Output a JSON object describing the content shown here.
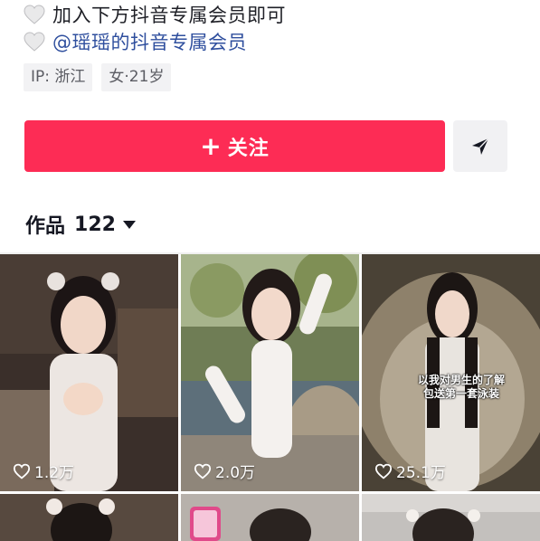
{
  "bio": {
    "line1": "加入下方抖音专属会员即可",
    "line2": "@瑶瑶的抖音专属会员"
  },
  "tags": [
    {
      "label": "IP: 浙江"
    },
    {
      "label": "女·21岁"
    }
  ],
  "actions": {
    "follow_label": "关注",
    "follow_icon": "plus-icon",
    "share_icon": "send-icon"
  },
  "works": {
    "label": "作品",
    "count": "122"
  },
  "grid": {
    "tiles": [
      {
        "likes": "1.2万"
      },
      {
        "likes": "2.0万"
      },
      {
        "likes": "25.1万",
        "caption": "以我对男生的了解\n包送第一套泳装"
      }
    ]
  },
  "colors": {
    "accent": "#fd2c55",
    "mention": "#2f4f9e",
    "tag_bg": "#f2f2f4"
  }
}
